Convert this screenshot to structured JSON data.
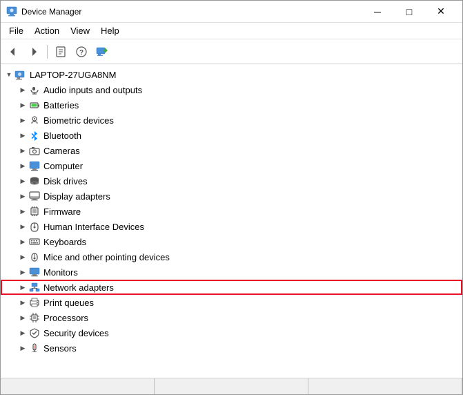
{
  "window": {
    "title": "Device Manager",
    "title_icon": "⚙"
  },
  "menu": {
    "items": [
      {
        "id": "file",
        "label": "File"
      },
      {
        "id": "action",
        "label": "Action"
      },
      {
        "id": "view",
        "label": "View"
      },
      {
        "id": "help",
        "label": "Help"
      }
    ]
  },
  "toolbar": {
    "buttons": [
      {
        "id": "back",
        "label": "◀",
        "title": "Back"
      },
      {
        "id": "forward",
        "label": "▶",
        "title": "Forward"
      },
      {
        "id": "properties",
        "label": "📋",
        "title": "Properties"
      },
      {
        "id": "help",
        "label": "❓",
        "title": "Help"
      },
      {
        "id": "update",
        "label": "🖥",
        "title": "Update driver"
      }
    ]
  },
  "tree": {
    "root": {
      "label": "LAPTOP-27UGA8NM",
      "icon": "💻"
    },
    "items": [
      {
        "id": "audio",
        "label": "Audio inputs and outputs",
        "icon": "🔊",
        "indent": 1
      },
      {
        "id": "batteries",
        "label": "Batteries",
        "icon": "🔋",
        "indent": 1
      },
      {
        "id": "biometric",
        "label": "Biometric devices",
        "icon": "👁",
        "indent": 1
      },
      {
        "id": "bluetooth",
        "label": "Bluetooth",
        "icon": "🔷",
        "indent": 1
      },
      {
        "id": "cameras",
        "label": "Cameras",
        "icon": "📷",
        "indent": 1
      },
      {
        "id": "computer",
        "label": "Computer",
        "icon": "🖥",
        "indent": 1
      },
      {
        "id": "disk",
        "label": "Disk drives",
        "icon": "💾",
        "indent": 1
      },
      {
        "id": "display",
        "label": "Display adapters",
        "icon": "🖥",
        "indent": 1
      },
      {
        "id": "firmware",
        "label": "Firmware",
        "icon": "📦",
        "indent": 1
      },
      {
        "id": "hid",
        "label": "Human Interface Devices",
        "icon": "🖱",
        "indent": 1
      },
      {
        "id": "keyboards",
        "label": "Keyboards",
        "icon": "⌨",
        "indent": 1
      },
      {
        "id": "mice",
        "label": "Mice and other pointing devices",
        "icon": "🖱",
        "indent": 1
      },
      {
        "id": "monitors",
        "label": "Monitors",
        "icon": "🖥",
        "indent": 1
      },
      {
        "id": "network",
        "label": "Network adapters",
        "icon": "🖥",
        "indent": 1,
        "highlighted": true
      },
      {
        "id": "print",
        "label": "Print queues",
        "icon": "🖨",
        "indent": 1
      },
      {
        "id": "processors",
        "label": "Processors",
        "icon": "⚙",
        "indent": 1
      },
      {
        "id": "security",
        "label": "Security devices",
        "icon": "📦",
        "indent": 1
      },
      {
        "id": "sensors",
        "label": "Sensors",
        "icon": "📡",
        "indent": 1
      }
    ]
  },
  "titlebar": {
    "minimize": "─",
    "maximize": "□",
    "close": "✕"
  }
}
